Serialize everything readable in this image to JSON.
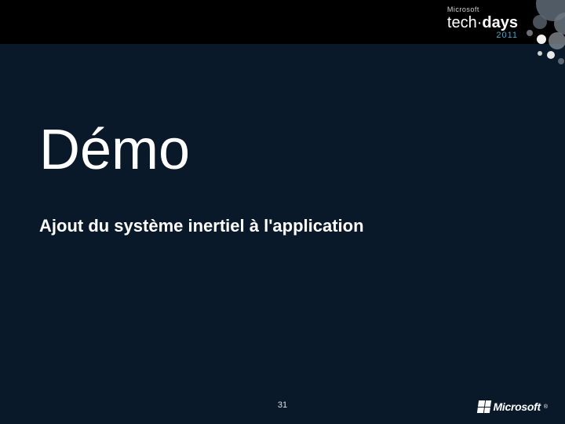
{
  "header": {
    "microsoft_label": "Microsoft",
    "techdays_light": "tech",
    "techdays_dot": "·",
    "techdays_bold": "days",
    "year": "2011"
  },
  "slide": {
    "title": "Démo",
    "subtitle": "Ajout du système inertiel à l'application",
    "page_number": "31"
  },
  "footer": {
    "company": "Microsoft",
    "registered": "®"
  },
  "colors": {
    "background": "#0a1929",
    "accent": "#4aa0c4"
  }
}
